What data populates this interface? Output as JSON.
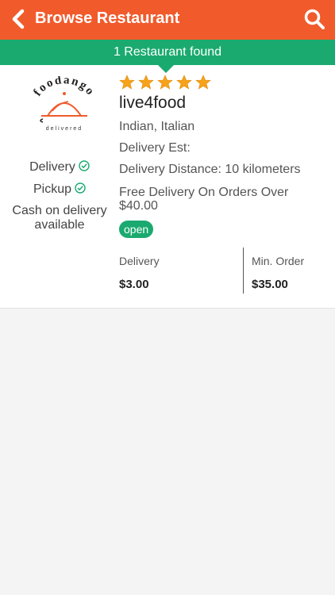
{
  "header": {
    "title": "Browse Restaurant",
    "back_icon": "chevron-left-icon",
    "search_icon": "search-icon",
    "color": "#f15b2c"
  },
  "results": {
    "count_text": "1 Restaurant found",
    "color": "#1aaa6f"
  },
  "restaurant": {
    "logo": {
      "brand": "foodango",
      "tagline": "delivered"
    },
    "rating": 5,
    "name": "live4food",
    "cuisine": "Indian, Italian",
    "delivery_est": "Delivery Est:",
    "delivery_distance": "Delivery Distance: 10 kilometers",
    "free_delivery": "Free Delivery On Orders Over $40.00",
    "status": "open",
    "features": {
      "delivery": "Delivery",
      "pickup": "Pickup",
      "cash": "Cash on delivery available"
    },
    "fees": {
      "delivery_label": "Delivery",
      "delivery_value": "$3.00",
      "min_order_label": "Min. Order",
      "min_order_value": "$35.00"
    }
  }
}
